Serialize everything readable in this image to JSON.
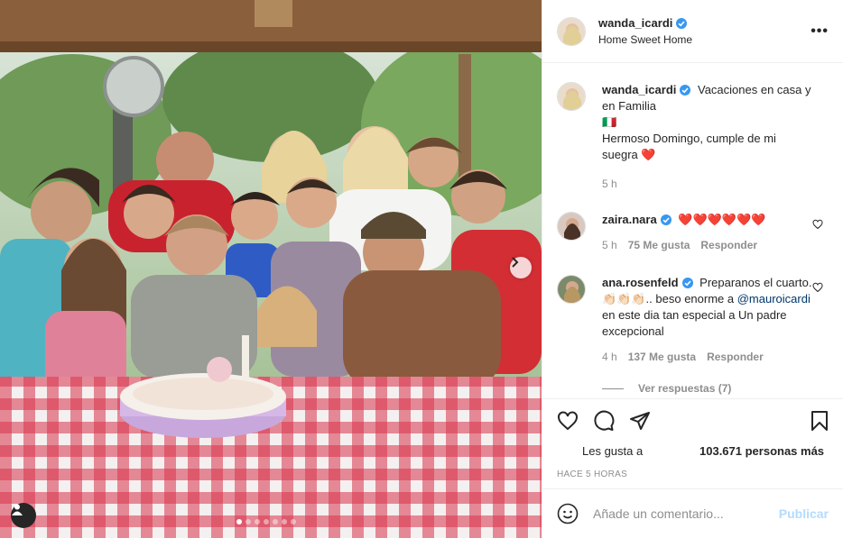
{
  "post": {
    "author": "wanda_icardi",
    "location": "Home Sweet Home",
    "more_icon": "more-options-icon",
    "carousel": {
      "slides": 7,
      "active": 1
    }
  },
  "caption": {
    "author": "wanda_icardi",
    "line1": "Vacaciones en casa y en Familia",
    "line2": "🇮🇹",
    "line3": "Hermoso Domingo, cumple de mi suegra ❤️",
    "time": "5 h"
  },
  "comments": [
    {
      "author": "zaira.nara",
      "text": "❤️❤️❤️❤️❤️❤️",
      "time": "5 h",
      "likes": "75 Me gusta",
      "reply": "Responder"
    },
    {
      "author": "ana.rosenfeld",
      "text_a": "Preparanos el cuarto.👏🏻👏🏻👏🏻.. beso enorme a ",
      "mention": "@mauroicardi",
      "text_b": " en este dia tan especial a Un padre excepcional",
      "time": "4 h",
      "likes": "137 Me gusta",
      "reply": "Responder"
    }
  ],
  "view_replies": "Ver respuestas (7)",
  "stats": {
    "likes_label": "Les gusta a",
    "likes_count": "103.671 personas más",
    "posted": "HACE 5 HORAS"
  },
  "composer": {
    "placeholder": "Añade un comentario...",
    "publish": "Publicar"
  },
  "colors": {
    "accent": "#0095f6",
    "heart": "#ed4956",
    "verified": "#3897f0",
    "publish_disabled": "#b3dbff"
  }
}
